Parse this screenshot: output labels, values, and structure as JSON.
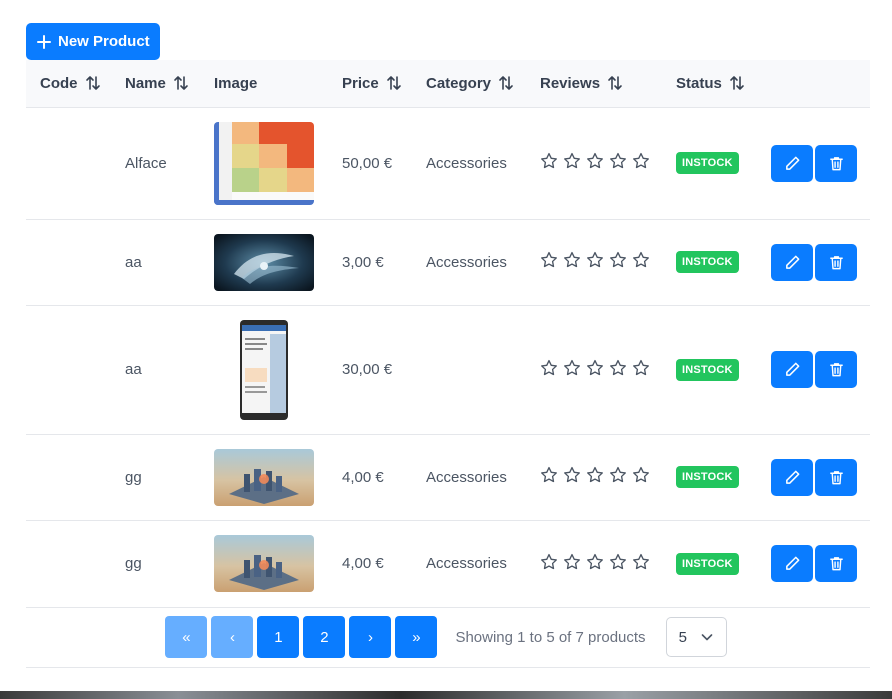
{
  "toolbar": {
    "new_product_label": "New Product"
  },
  "columns": {
    "code": "Code",
    "name": "Name",
    "image": "Image",
    "price": "Price",
    "category": "Category",
    "reviews": "Reviews",
    "status": "Status"
  },
  "rows": [
    {
      "code": "",
      "name": "Alface",
      "price": "50,00 €",
      "category": "Accessories",
      "rating": 0,
      "status": "INSTOCK"
    },
    {
      "code": "",
      "name": "aa",
      "price": "3,00 €",
      "category": "Accessories",
      "rating": 0,
      "status": "INSTOCK"
    },
    {
      "code": "",
      "name": "aa",
      "price": "30,00 €",
      "category": "",
      "rating": 0,
      "status": "INSTOCK"
    },
    {
      "code": "",
      "name": "gg",
      "price": "4,00 €",
      "category": "Accessories",
      "rating": 0,
      "status": "INSTOCK"
    },
    {
      "code": "",
      "name": "gg",
      "price": "4,00 €",
      "category": "Accessories",
      "rating": 0,
      "status": "INSTOCK"
    }
  ],
  "pagination": {
    "first": "«",
    "prev": "‹",
    "pages": [
      "1",
      "2"
    ],
    "next": "›",
    "last": "»",
    "report": "Showing 1 to 5 of 7 products",
    "rows_per_page": "5"
  },
  "colors": {
    "primary": "#0a7cff",
    "primary_disabled": "#66aeff",
    "status_instock": "#22c55e"
  },
  "icons": {
    "new": "plus-icon",
    "sort": "sort-icon",
    "star": "star-outline-icon",
    "edit": "pencil-icon",
    "delete": "trash-icon",
    "dropdown": "chevron-down-icon"
  }
}
